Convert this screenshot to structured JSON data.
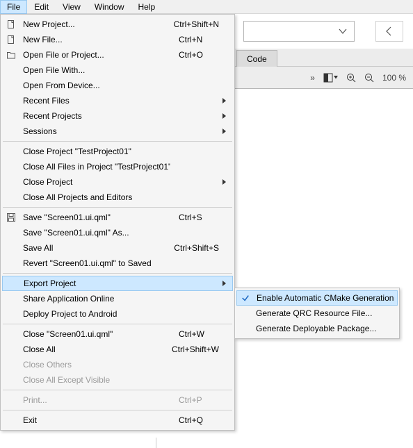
{
  "menubar": {
    "items": [
      "File",
      "Edit",
      "View",
      "Window",
      "Help"
    ],
    "active_index": 0
  },
  "background": {
    "combo_value": "",
    "tab_label": "Code",
    "zoom_label": "100 %",
    "more_glyph": "»"
  },
  "file_menu": {
    "items": [
      {
        "type": "item",
        "label": "New Project...",
        "shortcut": "Ctrl+Shift+N",
        "icon": "new-project-icon",
        "submenu": false
      },
      {
        "type": "item",
        "label": "New File...",
        "shortcut": "Ctrl+N",
        "icon": "new-file-icon",
        "submenu": false
      },
      {
        "type": "item",
        "label": "Open File or Project...",
        "shortcut": "Ctrl+O",
        "icon": "open-folder-icon",
        "submenu": false
      },
      {
        "type": "item",
        "label": "Open File With...",
        "shortcut": "",
        "icon": "",
        "submenu": false
      },
      {
        "type": "item",
        "label": "Open From Device...",
        "shortcut": "",
        "icon": "",
        "submenu": false
      },
      {
        "type": "item",
        "label": "Recent Files",
        "shortcut": "",
        "icon": "",
        "submenu": true
      },
      {
        "type": "item",
        "label": "Recent Projects",
        "shortcut": "",
        "icon": "",
        "submenu": true
      },
      {
        "type": "item",
        "label": "Sessions",
        "shortcut": "",
        "icon": "",
        "submenu": true
      },
      {
        "type": "sep"
      },
      {
        "type": "item",
        "label": "Close Project \"TestProject01\"",
        "shortcut": "",
        "icon": "",
        "submenu": false
      },
      {
        "type": "item",
        "label": "Close All Files in Project \"TestProject01\"",
        "shortcut": "",
        "icon": "",
        "submenu": false
      },
      {
        "type": "item",
        "label": "Close Project",
        "shortcut": "",
        "icon": "",
        "submenu": true
      },
      {
        "type": "item",
        "label": "Close All Projects and Editors",
        "shortcut": "",
        "icon": "",
        "submenu": false
      },
      {
        "type": "sep"
      },
      {
        "type": "item",
        "label": "Save \"Screen01.ui.qml\"",
        "shortcut": "Ctrl+S",
        "icon": "save-icon",
        "submenu": false
      },
      {
        "type": "item",
        "label": "Save \"Screen01.ui.qml\" As...",
        "shortcut": "",
        "icon": "",
        "submenu": false
      },
      {
        "type": "item",
        "label": "Save All",
        "shortcut": "Ctrl+Shift+S",
        "icon": "",
        "submenu": false
      },
      {
        "type": "item",
        "label": "Revert \"Screen01.ui.qml\" to Saved",
        "shortcut": "",
        "icon": "",
        "submenu": false
      },
      {
        "type": "sep"
      },
      {
        "type": "item",
        "label": "Export Project",
        "shortcut": "",
        "icon": "",
        "submenu": true,
        "highlight": true
      },
      {
        "type": "item",
        "label": "Share Application Online",
        "shortcut": "",
        "icon": "",
        "submenu": false
      },
      {
        "type": "item",
        "label": "Deploy Project to Android",
        "shortcut": "",
        "icon": "",
        "submenu": false
      },
      {
        "type": "sep"
      },
      {
        "type": "item",
        "label": "Close \"Screen01.ui.qml\"",
        "shortcut": "Ctrl+W",
        "icon": "",
        "submenu": false
      },
      {
        "type": "item",
        "label": "Close All",
        "shortcut": "Ctrl+Shift+W",
        "icon": "",
        "submenu": false
      },
      {
        "type": "item",
        "label": "Close Others",
        "shortcut": "",
        "icon": "",
        "submenu": false,
        "disabled": true
      },
      {
        "type": "item",
        "label": "Close All Except Visible",
        "shortcut": "",
        "icon": "",
        "submenu": false,
        "disabled": true
      },
      {
        "type": "sep"
      },
      {
        "type": "item",
        "label": "Print...",
        "shortcut": "Ctrl+P",
        "icon": "",
        "submenu": false,
        "disabled": true
      },
      {
        "type": "sep"
      },
      {
        "type": "item",
        "label": "Exit",
        "shortcut": "Ctrl+Q",
        "icon": "",
        "submenu": false
      }
    ]
  },
  "export_submenu": {
    "items": [
      {
        "label": "Enable Automatic CMake Generation",
        "checked": true,
        "highlight": true
      },
      {
        "label": "Generate QRC Resource File...",
        "checked": false
      },
      {
        "label": "Generate Deployable Package...",
        "checked": false
      }
    ]
  }
}
